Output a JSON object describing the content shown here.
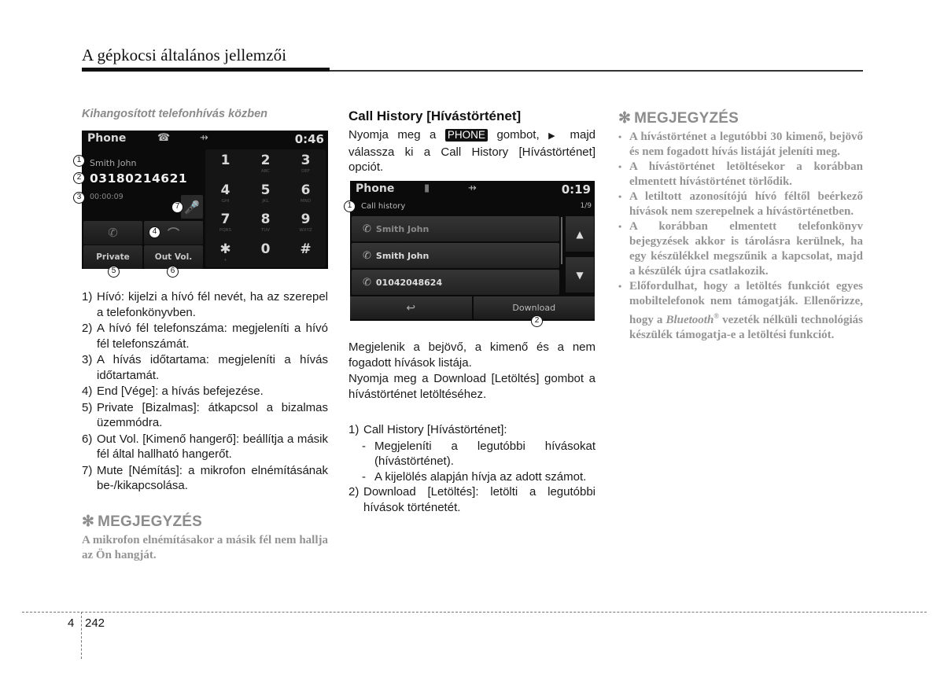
{
  "header": {
    "title": "A gépkocsi általános jellemzői"
  },
  "col1": {
    "subheading": "Kihangosított telefonhívás közben",
    "screen": {
      "title": "Phone",
      "time": "0:46",
      "caller_name": "Smith John",
      "caller_number": "03180214621",
      "duration": "00:00:09",
      "buttons": {
        "private": "Private",
        "out_vol": "Out Vol."
      },
      "keypad": [
        {
          "num": "1",
          "sub": ""
        },
        {
          "num": "2",
          "sub": "ABC"
        },
        {
          "num": "3",
          "sub": "DEF"
        },
        {
          "num": "4",
          "sub": "GHI"
        },
        {
          "num": "5",
          "sub": "JKL"
        },
        {
          "num": "6",
          "sub": "MNO"
        },
        {
          "num": "7",
          "sub": "PQRS"
        },
        {
          "num": "8",
          "sub": "TUV"
        },
        {
          "num": "9",
          "sub": "WXYZ"
        },
        {
          "num": "✱",
          "sub": "+"
        },
        {
          "num": "0",
          "sub": ""
        },
        {
          "num": "#",
          "sub": ""
        }
      ],
      "callouts": [
        "1",
        "2",
        "3",
        "4",
        "5",
        "6",
        "7"
      ]
    },
    "list": [
      {
        "n": "1)",
        "text": "Hívó: kijelzi a hívó fél nevét, ha az szerepel a telefonkönyvben."
      },
      {
        "n": "2)",
        "text": "A hívó fél telefonszáma: megjeleníti a hívó fél telefonszámát."
      },
      {
        "n": "3)",
        "text": "A hívás időtartama: megjeleníti a hívás időtartamát."
      },
      {
        "n": "4)",
        "text": "End [Vége]: a hívás befejezése."
      },
      {
        "n": "5)",
        "text": "Private [Bizalmas]: átkapcsol a bizalmas üzemmódra."
      },
      {
        "n": "6)",
        "text": "Out Vol. [Kimenő hangerő]: beállítja a másik fél által hallható hangerőt."
      },
      {
        "n": "7)",
        "text": "Mute [Némítás]: a mikrofon elnémításának be-/kikapcsolása."
      }
    ],
    "note": {
      "asterisk": "✻",
      "heading": "MEGJEGYZÉS",
      "body": "A mikrofon elnémításakor a másik fél nem hallja az Ön hangját."
    }
  },
  "col2": {
    "heading": "Call History [Hívástörténet]",
    "intro_pre": "Nyomja meg a",
    "phone_key": "PHONE",
    "intro_mid": "gombot,",
    "triangle": "▶",
    "intro_post": "majd válassza ki a Call History [Hívástörténet] opciót.",
    "screen": {
      "title": "Phone",
      "time": "0:19",
      "list_label": "Call history",
      "page_indicator": "1/9",
      "rows": [
        "Smith John",
        "Smith John",
        "01042048624"
      ],
      "download_label": "Download",
      "callouts": [
        "1",
        "2"
      ]
    },
    "body1": "Megjelenik a bejövő, a kimenő és a nem fogadott hívások listája.",
    "body2": "Nyomja meg a Download [Letöltés] gombot a hívástörténet letöltéséhez.",
    "list": [
      {
        "n": "1)",
        "text": "Call History [Hívástörténet]:",
        "sub": [
          "Megjeleníti a legutóbbi hívásokat (hívástörténet).",
          "A kijelölés alapján hívja az adott számot."
        ]
      },
      {
        "n": "2)",
        "text": "Download [Letöltés]: letölti a legutóbbi hívások történetét."
      }
    ]
  },
  "col3": {
    "note": {
      "asterisk": "✻",
      "heading": "MEGJEGYZÉS",
      "bullets": [
        "A hívástörténet a legutóbbi 30 kimenő, bejövő és nem fogadott hívás listáját jeleníti meg.",
        "A hívástörténet letöltésekor a korábban elmentett hívástörténet törlődik.",
        "A letiltott azonosítójú hívó féltől beérkező hívások nem szerepelnek a hívástörténetben.",
        "A korábban elmentett telefonkönyv bejegyzések akkor is tárolásra kerülnek, ha egy készülékkel megszűnik a kapcsolat, majd a készülék újra csatlakozik."
      ],
      "last_bullet_pre": "Előfordulhat, hogy a letöltés funkciót egyes mobiltelefonok nem támogatják. Ellenőrizze, hogy a",
      "last_bullet_brand": "Bluetooth",
      "last_bullet_reg": "®",
      "last_bullet_post": "vezeték nélküli technológiás készülék támogatja-e a letöltési funkciót."
    }
  },
  "footer": {
    "chapter": "4",
    "page": "242"
  }
}
